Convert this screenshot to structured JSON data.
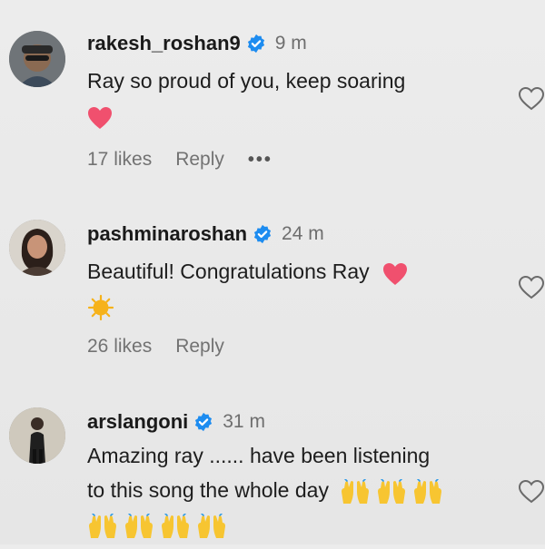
{
  "comments": [
    {
      "username": "rakesh_roshan9",
      "time": "9 m",
      "text": "Ray so proud of you, keep soaring",
      "likes": "17 likes",
      "reply": "Reply",
      "more": "•••"
    },
    {
      "username": "pashminaroshan",
      "time": "24 m",
      "text": "Beautiful! Congratulations Ray",
      "likes": "26 likes",
      "reply": "Reply"
    },
    {
      "username": "arslangoni",
      "time": "31 m",
      "text_line1": "Amazing ray ...... have been listening",
      "text_line2": "to this song the whole day"
    }
  ],
  "colors": {
    "verified": "#1d8cf0",
    "heart_emoji": "#f0506e",
    "sun_emoji": "#f6b21a",
    "hands_emoji": "#f7c531",
    "muted_text": "#727272"
  },
  "icons": {
    "verified": "verified-badge-icon",
    "like": "heart-outline-icon",
    "heart_emoji": "pink-heart-emoji",
    "sun_emoji": "sun-emoji",
    "hands_emoji": "raising-hands-emoji"
  }
}
